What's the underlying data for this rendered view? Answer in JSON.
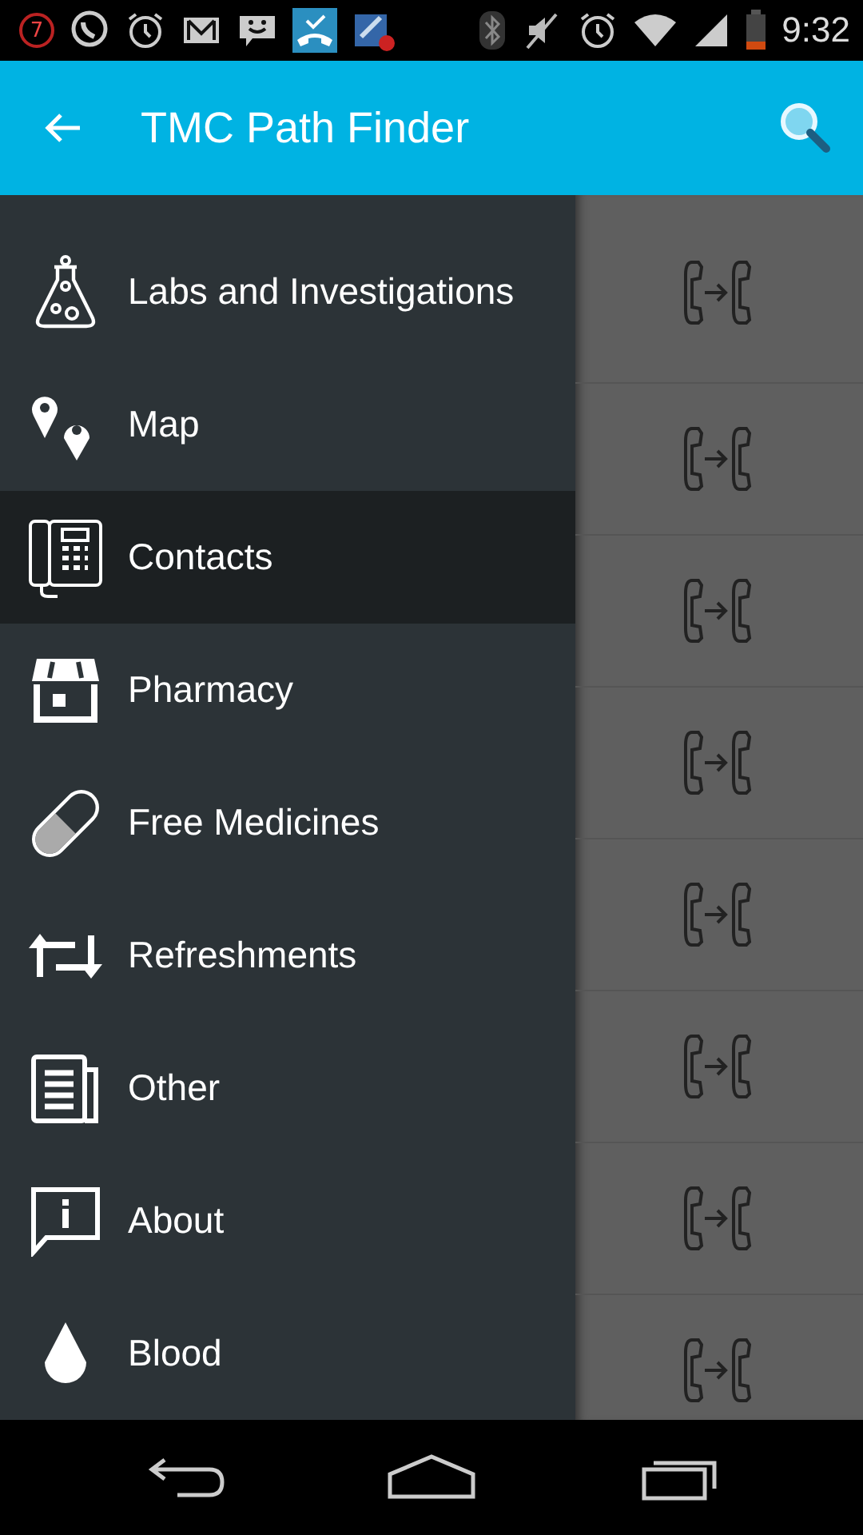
{
  "status_bar": {
    "notification_count": "7",
    "time": "9:32"
  },
  "app_bar": {
    "title": "TMC Path Finder"
  },
  "drawer": {
    "items": [
      {
        "label": "Labs and Investigations",
        "selected": false
      },
      {
        "label": "Map",
        "selected": false
      },
      {
        "label": "Contacts",
        "selected": true
      },
      {
        "label": "Pharmacy",
        "selected": false
      },
      {
        "label": "Free Medicines",
        "selected": false
      },
      {
        "label": "Refreshments",
        "selected": false
      },
      {
        "label": "Other",
        "selected": false
      },
      {
        "label": "About",
        "selected": false
      },
      {
        "label": "Blood",
        "selected": false
      }
    ]
  }
}
